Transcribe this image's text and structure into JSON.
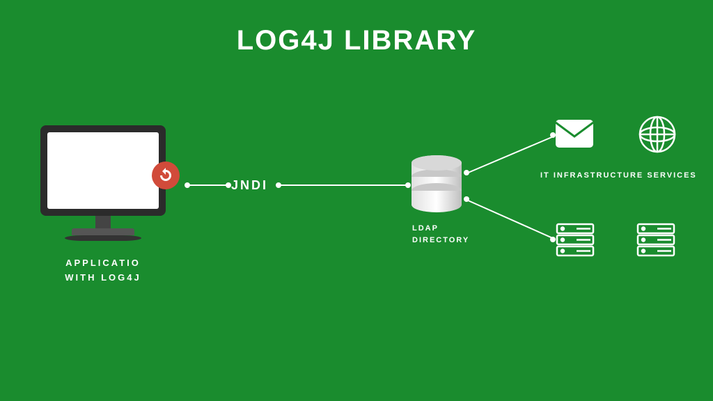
{
  "title": "LOG4J LIBRARY",
  "app": {
    "label1": "APPLICATIO",
    "label2": "WITH LOG4J"
  },
  "jndi": "JNDI",
  "db": {
    "label1": "LDAP",
    "label2": "DIRECTORY"
  },
  "services_label": "IT INFRASTRUCTURE SERVICES",
  "nodes": {
    "monitor": "application-with-log4j",
    "badge": "refresh-badge",
    "database": "ldap-directory",
    "mail": "mail-service",
    "globe": "web-service",
    "server1": "server-1",
    "server2": "server-2"
  },
  "connections": [
    {
      "from": "application-with-log4j",
      "via": "JNDI",
      "to": "ldap-directory"
    },
    {
      "from": "ldap-directory",
      "to": "mail-service"
    },
    {
      "from": "ldap-directory",
      "to": "server-1"
    }
  ]
}
